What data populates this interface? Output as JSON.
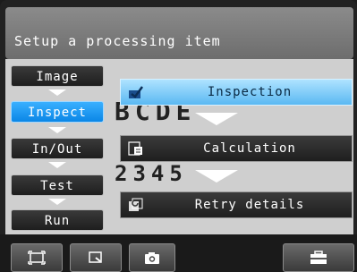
{
  "title_bar": {
    "title": "Setup a processing item"
  },
  "background_preview": {
    "row1": "BCDE",
    "row2": "2345"
  },
  "nav": {
    "items": [
      {
        "label": "Image",
        "active": false
      },
      {
        "label": "Inspect",
        "active": true
      },
      {
        "label": "In/Out",
        "active": false
      },
      {
        "label": "Test",
        "active": false
      },
      {
        "label": "Run",
        "active": false
      }
    ]
  },
  "menu": {
    "items": [
      {
        "label": "Inspection",
        "icon": "inspection-icon",
        "active": true
      },
      {
        "label": "Calculation",
        "icon": "calculation-icon",
        "active": false
      },
      {
        "label": "Retry details",
        "icon": "retry-details-icon",
        "active": false
      }
    ]
  },
  "toolbar": {
    "buttons": [
      {
        "icon": "fit-screen-icon"
      },
      {
        "icon": "zoom-window-icon"
      },
      {
        "icon": "camera-icon"
      },
      {
        "icon": "toolbox-icon"
      }
    ]
  },
  "colors": {
    "accent_blue": "#0a86e6",
    "active_menu_blue": "#5ab8f2"
  }
}
